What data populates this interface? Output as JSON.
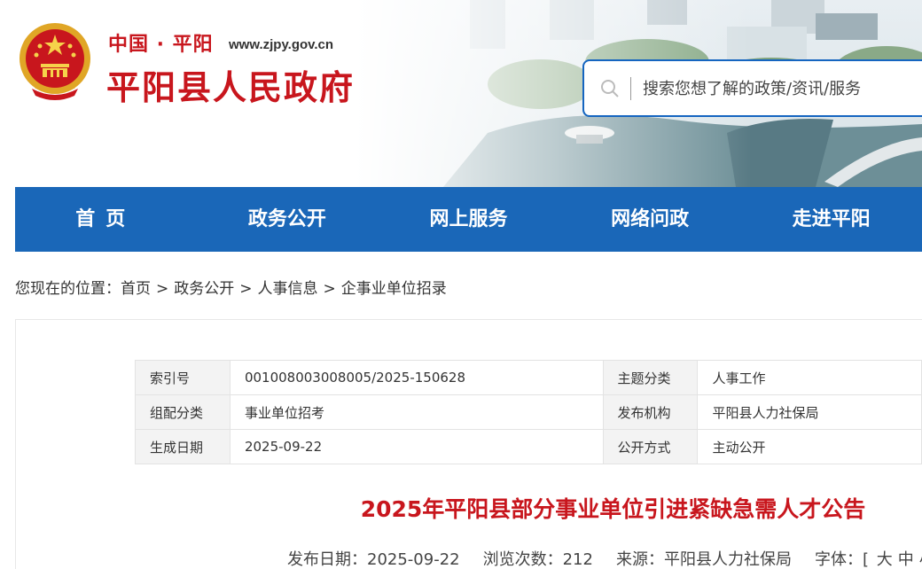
{
  "header": {
    "site_top": "中国 · 平阳",
    "site_url": "www.zjpy.gov.cn",
    "site_title": "平阳县人民政府",
    "emblem": "national-emblem",
    "brand_red": "#c8161d",
    "brand_blue": "#1a67b8"
  },
  "search": {
    "placeholder": "搜索您想了解的政策/资讯/服务",
    "icon": "search-icon"
  },
  "nav": {
    "items": [
      {
        "label": "首页"
      },
      {
        "label": "政务公开"
      },
      {
        "label": "网上服务"
      },
      {
        "label": "网络问政"
      },
      {
        "label": "走进平阳"
      }
    ]
  },
  "breadcrumb": {
    "prefix": "您现在的位置：",
    "items": [
      "首页",
      "政务公开",
      "人事信息",
      "企事业单位招录"
    ],
    "separator": ">"
  },
  "meta": {
    "rows": [
      {
        "k1": "索引号",
        "v1": "001008003008005/2025-150628",
        "k2": "主题分类",
        "v2": "人事工作"
      },
      {
        "k1": "组配分类",
        "v1": "事业单位招考",
        "k2": "发布机构",
        "v2": "平阳县人力社保局"
      },
      {
        "k1": "生成日期",
        "v1": "2025-09-22",
        "k2": "公开方式",
        "v2": "主动公开"
      }
    ]
  },
  "article": {
    "title": "2025年平阳县部分事业单位引进紧缺急需人才公告",
    "publish_label": "发布日期：",
    "publish_date": "2025-09-22",
    "views_label": "浏览次数：",
    "views": "212",
    "source_label": "来源：",
    "source": "平阳县人力社保局",
    "font_label": "字体：",
    "font_open": "[",
    "font_large": "大",
    "font_medium": "中",
    "font_small": "小",
    "font_close": "]"
  }
}
